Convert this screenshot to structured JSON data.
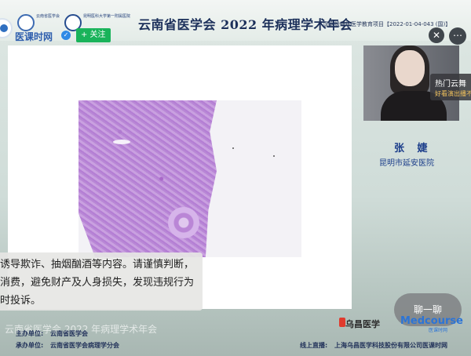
{
  "header": {
    "logo_left_caption": "云南省医学会",
    "logo_right_caption": "昆明医科大学第一附属医院",
    "title": "云南省医学会 2022 年病理学术年会",
    "subnote": "国家级继续医学教育项目【2022-01-04-043 (国)】"
  },
  "channel": {
    "name": "医课时网",
    "verified_icon": "✓",
    "follow_label": "+ 关注",
    "close_label": "✕",
    "more_label": "⋯"
  },
  "speaker": {
    "name": "张 婕",
    "organization": "昆明市延安医院"
  },
  "hot_card": {
    "title": "热门云舞",
    "subtitle": "好看演出播不"
  },
  "notice": {
    "line1": "诱导欺诈、抽烟酗酒等内容。请谨慎判断，",
    "line2": "消费，避免财产及人身损失，发现违规行为",
    "line3": "时投诉。"
  },
  "watermark": "云南省医学会 2022 年病理学术年会",
  "footer": {
    "host_label": "主办单位:",
    "host_value": "云南省医学会",
    "organizer_label": "承办单位:",
    "organizer_value": "云南省医学会病理学分会",
    "live_label": "线上直播:",
    "live_value": "上海乌昌医学科技股份有限公司医课时网"
  },
  "chat_button": "聊一聊",
  "brands": {
    "brand1": "乌昌医学",
    "brand2": "Medcourse",
    "brand2_sub": "医课时网"
  },
  "colors": {
    "title": "#1b2f5a",
    "follow": "#19b35a",
    "speaker_text": "#1b3d8a",
    "tissue_stain": "#b47ed4"
  }
}
